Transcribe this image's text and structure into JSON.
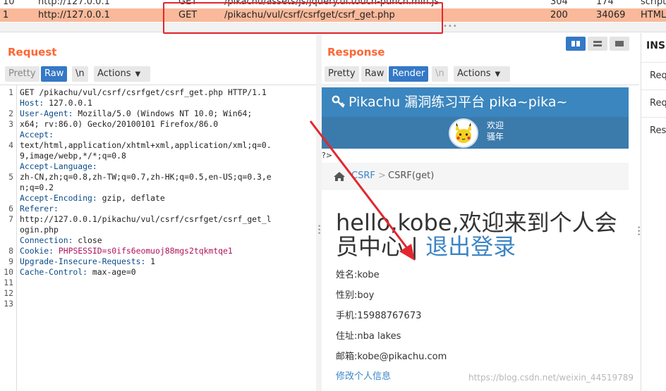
{
  "history": {
    "rows": [
      {
        "num": "10",
        "host": "http://127.0.0.1",
        "method": "GET",
        "url": "/pikachu/assets/js/jquery.ui.touch-punch.min.js",
        "status": "304",
        "length": "174",
        "mime": "script"
      },
      {
        "num": "1",
        "host": "http://127.0.0.1",
        "method": "GET",
        "url": "/pikachu/vul/csrf/csrfget/csrf_get.php",
        "status": "200",
        "length": "34069",
        "mime": "HTML"
      }
    ]
  },
  "request": {
    "title": "Request",
    "tabs": {
      "pretty": "Pretty",
      "raw": "Raw",
      "newline": "\\n",
      "actions": "Actions"
    },
    "line_numbers": [
      "1",
      "",
      "2",
      "3",
      "",
      "4",
      "",
      "",
      "5",
      "",
      "",
      "6",
      "7",
      "",
      "",
      "8",
      "9",
      "10",
      "11",
      "12",
      "13"
    ],
    "lines": [
      {
        "plain": "GET /pikachu/vul/csrf/csrfget/csrf_get.php HTTP/1.1"
      },
      {
        "key": "Host:",
        "value": " 127.0.0.1"
      },
      {
        "key": "User-Agent:",
        "value": " Mozilla/5.0 (Windows NT 10.0; Win64;\nx64; rv:86.0) Gecko/20100101 Firefox/86.0"
      },
      {
        "key": "Accept:",
        "value": "\ntext/html,application/xhtml+xml,application/xml;q=0.\n9,image/webp,*/*;q=0.8"
      },
      {
        "key": "Accept-Language:",
        "value": "\nzh-CN,zh;q=0.8,zh-TW;q=0.7,zh-HK;q=0.5,en-US;q=0.3,e\nn;q=0.2"
      },
      {
        "key": "Accept-Encoding:",
        "value": " gzip, deflate"
      },
      {
        "key": "Referer:",
        "value": "\nhttp://127.0.0.1/pikachu/vul/csrf/csrfget/csrf_get_l\nogin.php"
      },
      {
        "key": "Connection:",
        "value": " close"
      },
      {
        "key": "Cookie:",
        "ckey": " PHPSESSID",
        "cval": "=s0ifs6eomuoj88mgs2tqkmtqe1"
      },
      {
        "key": "Upgrade-Insecure-Requests:",
        "value": " 1"
      },
      {
        "key": "Cache-Control:",
        "value": " max-age=0"
      }
    ]
  },
  "response": {
    "title": "Response",
    "tabs": {
      "pretty": "Pretty",
      "raw": "Raw",
      "render": "Render",
      "newline": "\\n",
      "actions": "Actions"
    },
    "page": {
      "header": "Pikachu 漏洞练习平台 pika~pika~",
      "welcome": "欢迎\n骚年",
      "stray": "?>",
      "crumb1": "CSRF",
      "crumb_sep": ">",
      "crumb2": "CSRF(get)",
      "hello": "hello,kobe,欢迎来到个人会员中心 | ",
      "logout": "退出登录",
      "name": "姓名:kobe",
      "sex": "性别:boy",
      "phone": "手机:15988767673",
      "address": "住址:nba lakes",
      "email": "邮箱:kobe@pikachu.com",
      "edit": "修改个人信息"
    }
  },
  "inspector": {
    "title": "INSPECTOR",
    "items": [
      "Request Query Parameters",
      "Request Headers",
      "Response Headers"
    ]
  },
  "watermark": "https://blog.csdn.net/weixin_44519789",
  "colors": {
    "accent": "#ff6633",
    "selected_row": "#f9b99a",
    "active_tab": "#3478c6",
    "annotation": "#e3262e"
  }
}
